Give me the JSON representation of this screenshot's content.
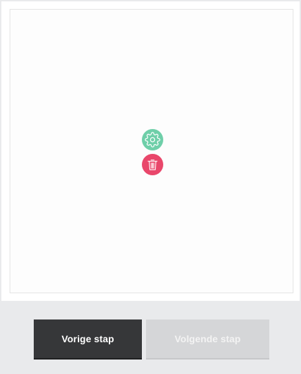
{
  "editor": {
    "settings_icon": "gear-icon",
    "delete_icon": "trash-icon",
    "colors": {
      "settings": "#6fcfa9",
      "delete": "#e9476b"
    }
  },
  "navigation": {
    "prev_label": "Vorige stap",
    "next_label": "Volgende stap",
    "next_disabled": true,
    "colors": {
      "prev": "#363739",
      "next": "#d5d6d8"
    }
  }
}
